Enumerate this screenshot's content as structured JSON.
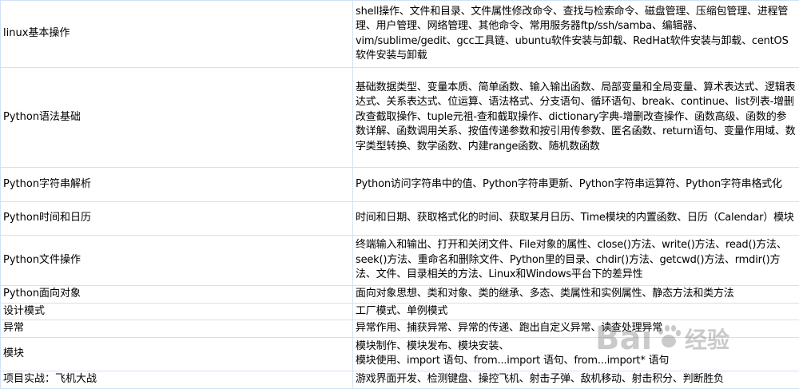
{
  "rows": [
    {
      "topic": "linux基本操作",
      "detail": "shell操作、文件和目录、文件属性修改命令、查找与检索命令、磁盘管理、压缩包管理、进程管理、用户管理、网络管理、其他命令、常用服务器ftp/ssh/samba、编辑器、vim/sublime/gedit、gcc工具链、ubuntu软件安装与卸载、RedHat软件安装与卸载、centOS软件安装与卸载"
    },
    {
      "topic": "Python语法基础",
      "detail": "基础数据类型、变量本质、简单函数、输入输出函数、局部变量和全局变量、算术表达式、逻辑表达式、关系表达式、位运算、语法格式、分支语句、循环语句、break、continue、list列表-增删改查截取操作、tuple元祖-查和截取操作、dictionary字典-增删改查操作、函数高级、函数的参数详解、函数调用关系、按值传递参数和按引用传参数、匿名函数、return语句、变量作用域、数字类型转换、数学函数、内建range函数、随机数函数"
    },
    {
      "topic": "Python字符串解析",
      "detail": "Python访问字符串中的值、Python字符串更新、Python字符串运算符、Python字符串格式化"
    },
    {
      "topic": "Python时间和日历",
      "detail": "时间和日期、获取格式化的时间、获取某月日历、Time模块的内置函数、日历（Calendar）模块"
    },
    {
      "topic": "Python文件操作",
      "detail": "终端输入和输出、打开和关闭文件、File对象的属性、close()方法、write()方法、read()方法、seek()方法、重命名和删除文件、Python里的目录、chdir()方法、getcwd()方法、rmdir()方法、文件、目录相关的方法、Linux和Windows平台下的差异性"
    },
    {
      "topic": "Python面向对象",
      "detail": "面向对象思想、类和对象、类的继承、多态、类属性和实例属性、静态方法和类方法"
    },
    {
      "topic": "设计模式",
      "detail": "工厂模式、单例模式"
    },
    {
      "topic": "异常",
      "detail": "异常作用、捕获异常、异常的传递、跑出自定义异常、读查处理异常"
    },
    {
      "topic": "模块",
      "detail": "模块制作、模块发布、模块安装、\n模块使用、import 语句、from...import 语句、from...import* 语句"
    },
    {
      "topic": "项目实战：飞机大战",
      "detail": "游戏界面开发、检测键盘、操控飞机、射击子弹、敌机移动、射击积分、判断胜负"
    }
  ],
  "watermark": {
    "text": "Bai",
    "subtext": "经验",
    "icon": "baidu-paw-icon"
  }
}
